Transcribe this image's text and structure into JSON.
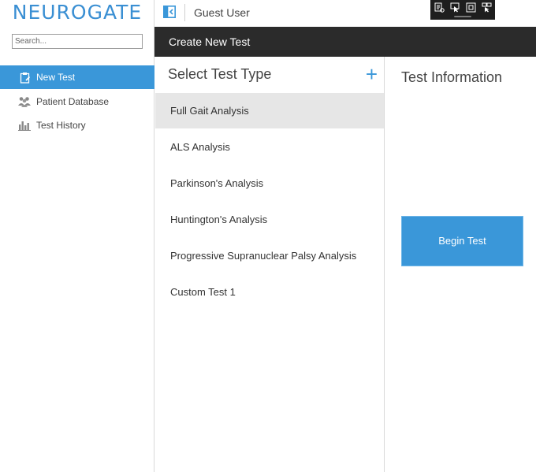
{
  "app": {
    "logo": "NEUROGATE"
  },
  "sidebar": {
    "search_placeholder": "Search...",
    "items": [
      {
        "label": "New Test",
        "icon": "clipboard-icon",
        "active": true
      },
      {
        "label": "Patient Database",
        "icon": "people-icon",
        "active": false
      },
      {
        "label": "Test History",
        "icon": "bar-chart-icon",
        "active": false
      }
    ]
  },
  "topbar": {
    "user": "Guest User"
  },
  "header": {
    "title": "Create New Test"
  },
  "test_types": {
    "title": "Select Test Type",
    "add_label": "+",
    "items": [
      {
        "label": "Full Gait Analysis",
        "selected": true
      },
      {
        "label": "ALS Analysis",
        "selected": false
      },
      {
        "label": "Parkinson's Analysis",
        "selected": false
      },
      {
        "label": "Huntington's Analysis",
        "selected": false
      },
      {
        "label": "Progressive Supranuclear Palsy Analysis",
        "selected": false
      },
      {
        "label": "Custom Test 1",
        "selected": false
      }
    ]
  },
  "info": {
    "title": "Test Information",
    "begin_label": "Begin Test"
  },
  "colors": {
    "accent": "#3a97d9",
    "header_bg": "#2b2b2b",
    "selected_bg": "#e6e6e6"
  }
}
